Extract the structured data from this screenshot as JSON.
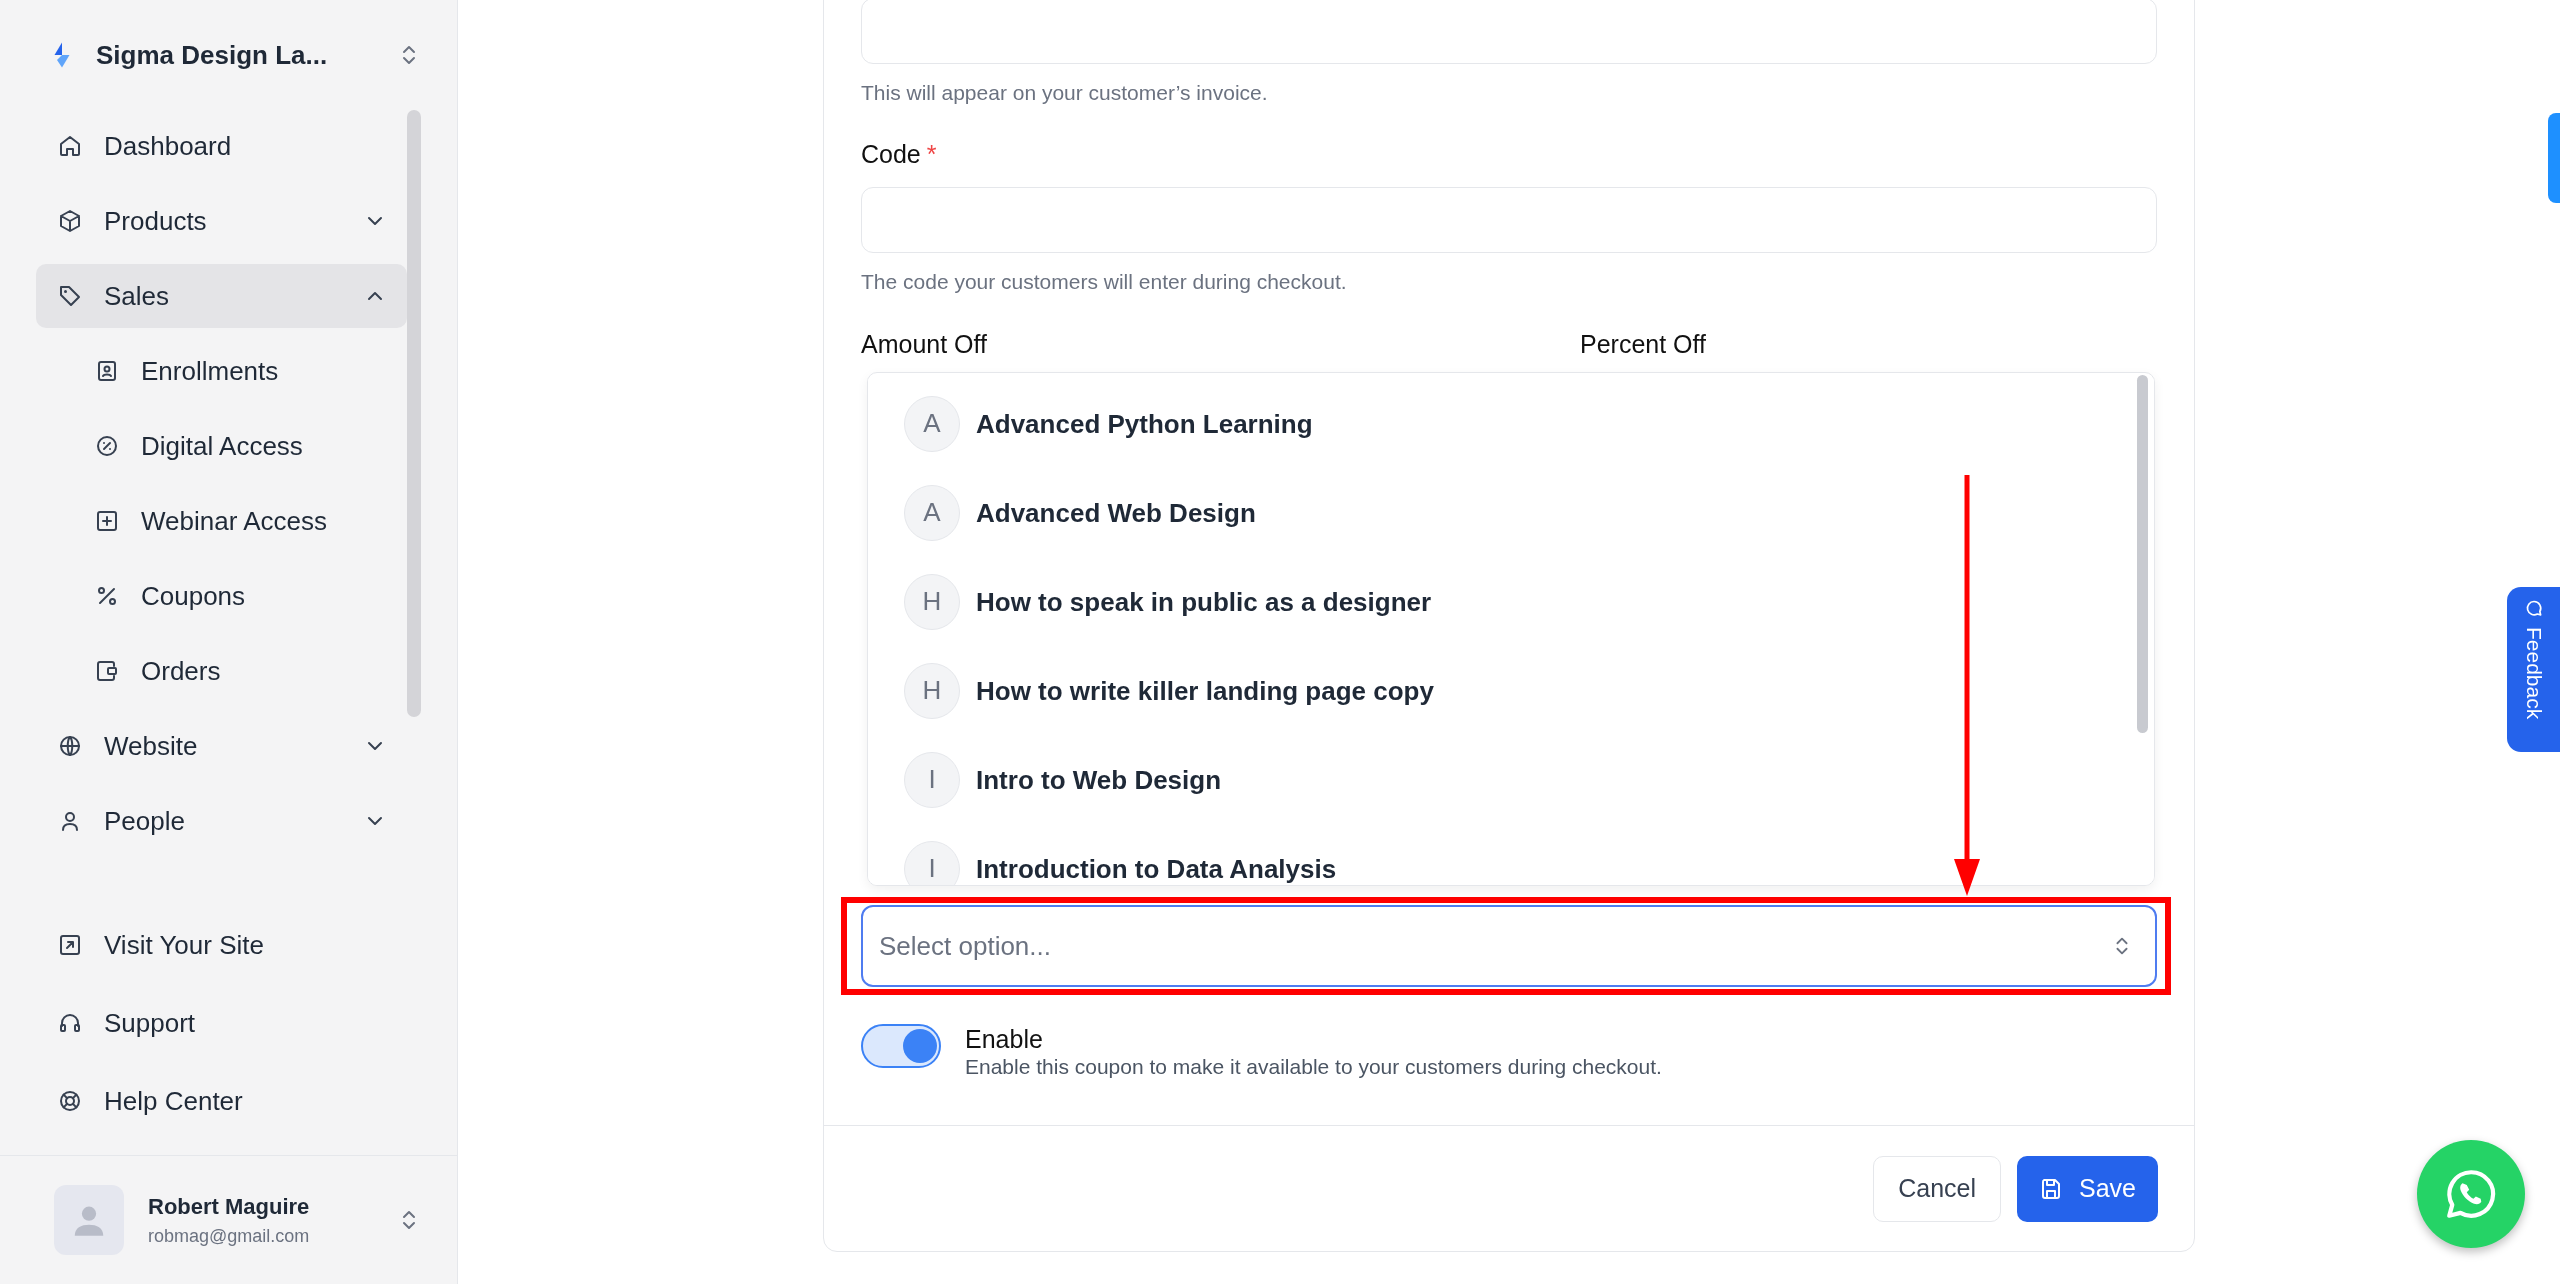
{
  "workspace": {
    "name": "Sigma Design La..."
  },
  "sidebar": {
    "items": [
      {
        "label": "Dashboard",
        "kind": "link",
        "selected": false
      },
      {
        "label": "Products",
        "kind": "group",
        "expanded": false,
        "selected": false
      },
      {
        "label": "Sales",
        "kind": "group",
        "expanded": true,
        "selected": true,
        "children": [
          {
            "label": "Enrollments"
          },
          {
            "label": "Digital Access"
          },
          {
            "label": "Webinar Access"
          },
          {
            "label": "Coupons"
          },
          {
            "label": "Orders"
          }
        ]
      },
      {
        "label": "Website",
        "kind": "group",
        "expanded": false,
        "selected": false
      },
      {
        "label": "People",
        "kind": "group",
        "expanded": false,
        "selected": false
      }
    ],
    "footer_links": [
      "Visit Your Site",
      "Support",
      "Help Center"
    ]
  },
  "user": {
    "name": "Robert Maguire",
    "email": "robmag@gmail.com"
  },
  "form": {
    "name_field": {
      "hint": "This will appear on your customer’s invoice."
    },
    "code_field": {
      "label": "Code",
      "required_mark": "*",
      "hint": "The code your customers will enter during checkout."
    },
    "amount_off": {
      "label": "Amount Off"
    },
    "percent_off": {
      "label": "Percent Off"
    },
    "product_dropdown": {
      "options": [
        {
          "letter": "A",
          "label": "Advanced Python Learning"
        },
        {
          "letter": "A",
          "label": "Advanced Web Design"
        },
        {
          "letter": "H",
          "label": "How to speak in public as a designer"
        },
        {
          "letter": "H",
          "label": "How to write killer landing page copy"
        },
        {
          "letter": "I",
          "label": "Intro to Web Design"
        },
        {
          "letter": "I",
          "label": "Introduction to Data Analysis"
        }
      ]
    },
    "product_select": {
      "placeholder": "Select option..."
    },
    "enable": {
      "label": "Enable",
      "description": "Enable this coupon to make it available to your customers during checkout.",
      "on": true
    },
    "buttons": {
      "cancel": "Cancel",
      "save": "Save"
    }
  },
  "feedback_tab": {
    "label": "Feedback"
  }
}
